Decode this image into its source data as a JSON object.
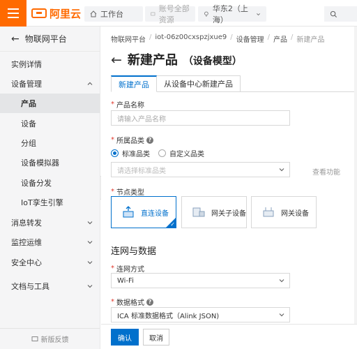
{
  "topbar": {
    "logo_text": "阿里云",
    "workspace": "工作台",
    "account": "账号全部资源",
    "region": "华东2（上海）",
    "accent": "#ff6a00"
  },
  "sidebar": {
    "back_title": "物联网平台",
    "items": [
      {
        "label": "实例详情"
      },
      {
        "label": "设备管理"
      },
      {
        "label": "产品"
      },
      {
        "label": "设备"
      },
      {
        "label": "分组"
      },
      {
        "label": "设备模拟器"
      },
      {
        "label": "设备分发"
      },
      {
        "label": "IoT孪生引擎"
      },
      {
        "label": "消息转发"
      },
      {
        "label": "监控运维"
      },
      {
        "label": "安全中心"
      },
      {
        "label": "文档与工具"
      }
    ],
    "footer": "新版反馈"
  },
  "breadcrumb": [
    "物联网平台",
    "iot-06z00cxspzjxue9",
    "设备管理",
    "产品",
    "新建产品"
  ],
  "page": {
    "title": "新建产品",
    "subtitle": "（设备模型）"
  },
  "tabs": [
    {
      "label": "新建产品",
      "active": true
    },
    {
      "label": "从设备中心新建产品",
      "active": false
    }
  ],
  "form": {
    "product_name_label": "产品名称",
    "product_name_placeholder": "请输入产品名称",
    "category_label": "所属品类",
    "category_options": [
      "标准品类",
      "自定义品类"
    ],
    "category_placeholder": "请选择标准品类",
    "category_link": "查看功能",
    "node_type_label": "节点类型",
    "node_types": [
      {
        "label": "直连设备",
        "selected": true
      },
      {
        "label": "网关子设备",
        "selected": false
      },
      {
        "label": "网关设备",
        "selected": false
      }
    ],
    "network_section": "连网与数据",
    "network_label": "连网方式",
    "network_value": "Wi-Fi",
    "data_format_label": "数据格式",
    "data_format_value": "ICA 标准数据格式（Alink JSON)"
  },
  "footer": {
    "confirm": "确认",
    "cancel": "取消"
  },
  "colors": {
    "primary": "#0070cc",
    "required": "#e0362b"
  }
}
